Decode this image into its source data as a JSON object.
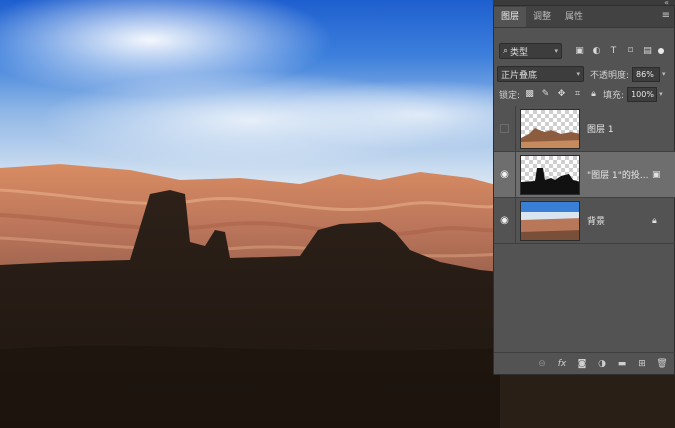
{
  "panel": {
    "collapse_glyph": "«",
    "tabs": [
      {
        "label": "图层",
        "active": true
      },
      {
        "label": "调整",
        "active": false
      },
      {
        "label": "属性",
        "active": false
      }
    ],
    "menu_icon": "panel-menu-icon",
    "filter": {
      "kind_label": "类型",
      "icons": [
        "pixel-filter-icon",
        "adjustment-filter-icon",
        "type-filter-icon",
        "shape-filter-icon",
        "smart-object-filter-icon"
      ]
    },
    "blend": {
      "mode": "正片叠底",
      "opacity_label": "不透明度:",
      "opacity_value": "86%",
      "lock_label": "锁定:",
      "fill_label": "填充:",
      "fill_value": "100%"
    },
    "layers": [
      {
        "name": "图层 1",
        "visible": false,
        "selected": false
      },
      {
        "name": "\"图层 1\"的投...",
        "visible": true,
        "selected": true
      },
      {
        "name": "背景",
        "visible": true,
        "selected": false,
        "locked": true
      }
    ],
    "bottom_icons": [
      "link-layers-icon",
      "fx-icon",
      "add-mask-icon",
      "adjustment-layer-icon",
      "group-folder-icon",
      "new-layer-icon",
      "delete-layer-icon"
    ]
  },
  "colors": {
    "panel_bg": "#535353",
    "selected_row": "#6e6e6e",
    "sky_blue": "#1e5fcf"
  }
}
